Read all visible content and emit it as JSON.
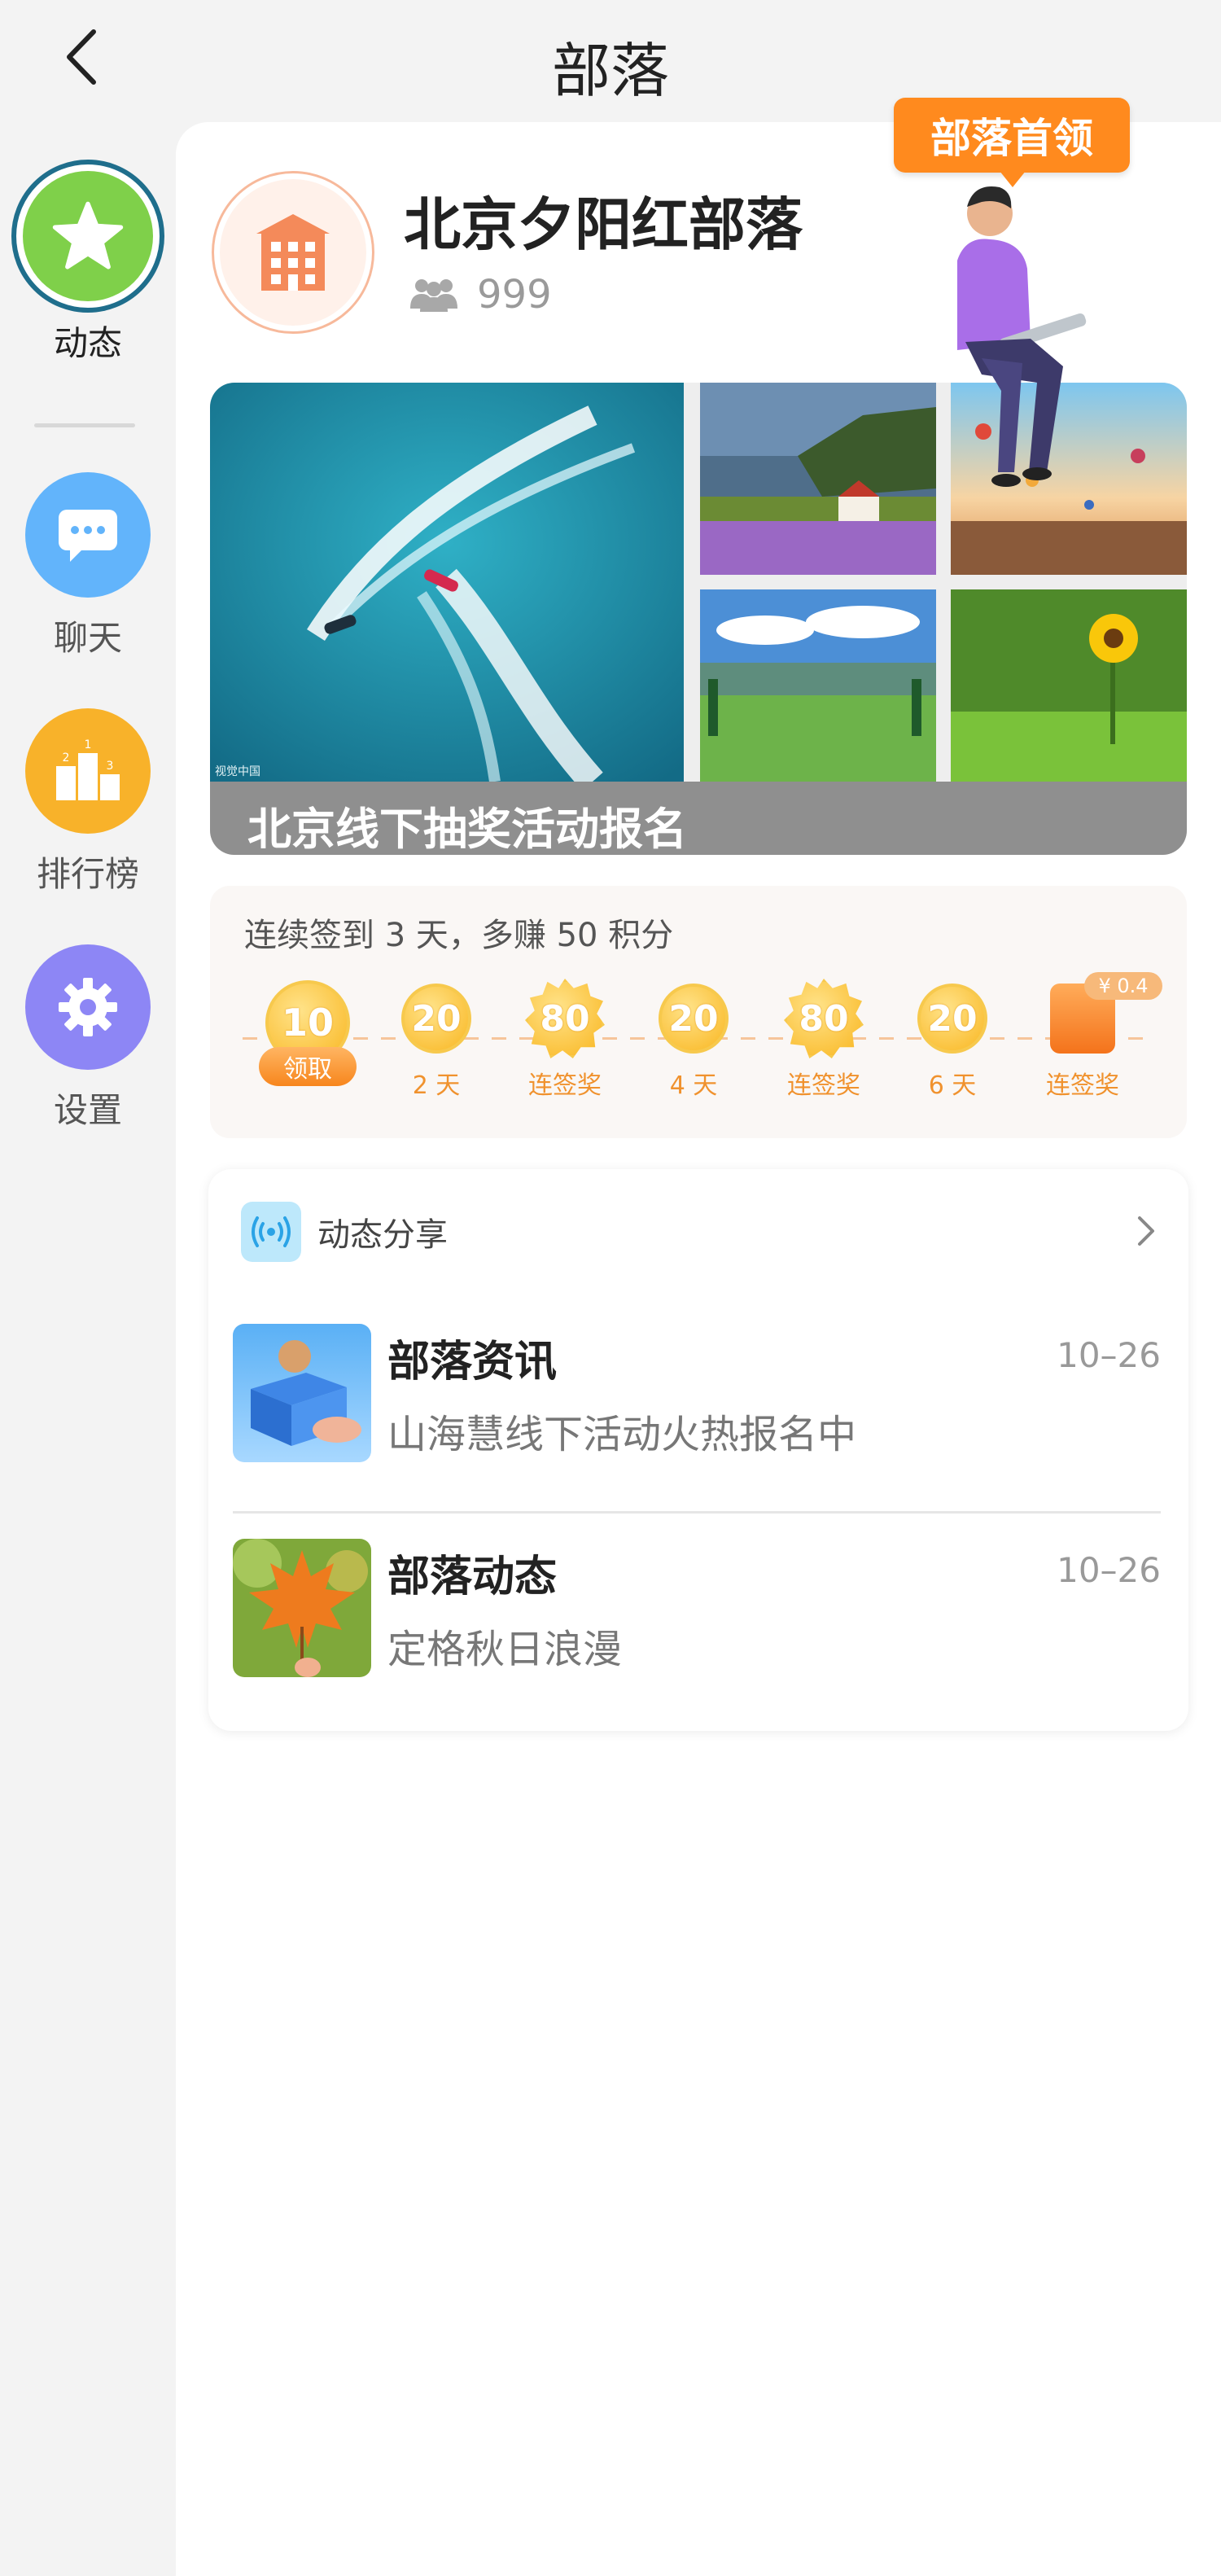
{
  "header": {
    "title": "部落"
  },
  "sidebar": {
    "items": [
      {
        "label": "动态",
        "icon": "star-icon",
        "color": "#7fd04a"
      },
      {
        "label": "聊天",
        "icon": "chat-icon",
        "color": "#62b4fb"
      },
      {
        "label": "排行榜",
        "icon": "ranking-icon",
        "color": "#f8b22a"
      },
      {
        "label": "设置",
        "icon": "gear-icon",
        "color": "#8d86f5"
      }
    ]
  },
  "tribe": {
    "name": "北京夕阳红部落",
    "members": "999",
    "chief_badge": "部落首领"
  },
  "banner": {
    "caption": "北京线下抽奖活动报名",
    "watermark": "视觉中国"
  },
  "checkin": {
    "text": "连续签到 3 天，多赚 50 积分",
    "days": [
      {
        "value": "10",
        "label": "领取"
      },
      {
        "value": "20",
        "label": "2 天"
      },
      {
        "value": "80",
        "label": "连签奖"
      },
      {
        "value": "20",
        "label": "4 天"
      },
      {
        "value": "80",
        "label": "连签奖"
      },
      {
        "value": "20",
        "label": "6 天"
      },
      {
        "value": "¥ 0.4",
        "label": "连签奖"
      }
    ]
  },
  "feed": {
    "title": "动态分享",
    "items": [
      {
        "title": "部落资讯",
        "date": "10–26",
        "subtitle": "山海慧线下活动火热报名中"
      },
      {
        "title": "部落动态",
        "date": "10–26",
        "subtitle": "定格秋日浪漫"
      }
    ]
  },
  "colors": {
    "accent": "#ff8a1e",
    "active_ring": "#1f6e8c",
    "coin": "#f9b620"
  }
}
